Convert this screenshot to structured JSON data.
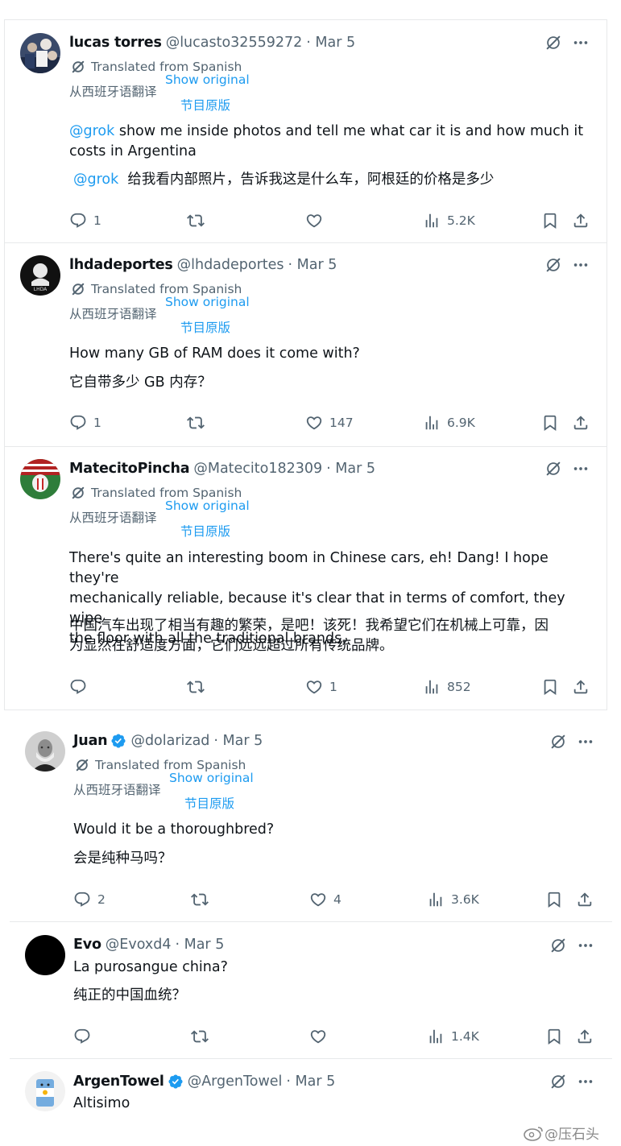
{
  "translated_from": "Translated from Spanish",
  "translated_from_zh": "从西班牙语翻译",
  "show_original": "Show original",
  "show_original_zh": "节目原版",
  "tweets": [
    {
      "name": "lucas torres",
      "handle": "@lucasto32559272",
      "date": "· Mar 5",
      "mention": "@grok",
      "body_en_1": "show me inside photos and tell me what car it is and how much it",
      "body_en_2": "costs in Argentina",
      "mention_zh": "@grok",
      "body_zh": "给我看内部照片，告诉我这是什么车，阿根廷的价格是多少",
      "replies": "1",
      "likes": "",
      "views": "5.2K"
    },
    {
      "name": "lhdadeportes",
      "handle": "@lhdadeportes",
      "date": "· Mar 5",
      "body_en": "How many GB of RAM does it come with?",
      "body_zh": "它自带多少 GB 内存？",
      "replies": "1",
      "likes": "147",
      "views": "6.9K"
    },
    {
      "name": "MatecitoPincha",
      "handle": "@Matecito182309",
      "date": "· Mar 5",
      "body_en_1": "There's quite an interesting boom in Chinese cars, eh! Dang! I hope they're",
      "body_en_2": "mechanically reliable, because it's clear that in terms of comfort, they wipe",
      "body_en_3": "the floor with all the traditional brands.",
      "body_zh_1": "中国汽车出现了相当有趣的繁荣，是吧！该死！我希望它们在机械上可靠，因",
      "body_zh_2": "为显然在舒适度方面，它们远远超过所有传统品牌。",
      "replies": "",
      "likes": "1",
      "views": "852"
    },
    {
      "name": "Juan",
      "handle": "@dolarizad",
      "date": "· Mar 5",
      "body_en": "Would it be a thoroughbred?",
      "body_zh": "会是纯种马吗？",
      "replies": "2",
      "likes": "4",
      "views": "3.6K"
    },
    {
      "name": "Evo",
      "handle": "@Evoxd4",
      "date": "· Mar 5",
      "body_en": "La purosangue china?",
      "body_zh": "纯正的中国血统？",
      "replies": "",
      "likes": "",
      "views": "1.4K"
    },
    {
      "name": "ArgenTowel",
      "handle": "@ArgenTowel",
      "date": "· Mar 5",
      "body_en": "Altisimo"
    }
  ],
  "watermark": "@压石头",
  "colors": {
    "accent": "#1d9bf0",
    "secondary": "#536471",
    "text": "#0f1419",
    "border": "#e7e9ea"
  }
}
